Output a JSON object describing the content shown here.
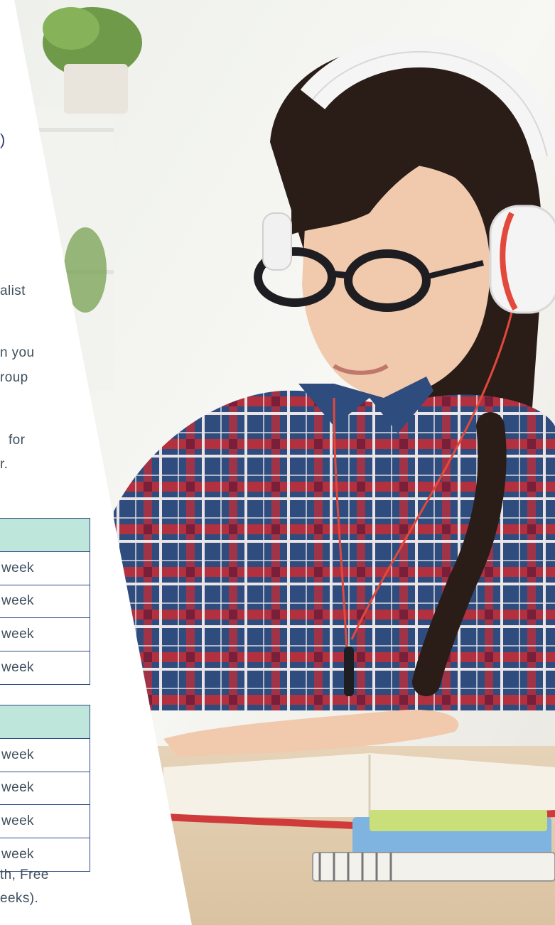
{
  "text": {
    "paren": ")",
    "line1": "alist",
    "line2": "n you",
    "line3": "roup",
    "line4": "for",
    "line5": "r.",
    "footer1": "th, Free",
    "footer2": "eeks)."
  },
  "table1": {
    "rows": [
      "week",
      "week",
      "week",
      "week"
    ]
  },
  "table2": {
    "rows": [
      "week",
      "week",
      "week",
      "week"
    ]
  },
  "colors": {
    "header_fill": "#bfe6da",
    "border": "#2f4a86",
    "text": "#3f4f5e"
  }
}
